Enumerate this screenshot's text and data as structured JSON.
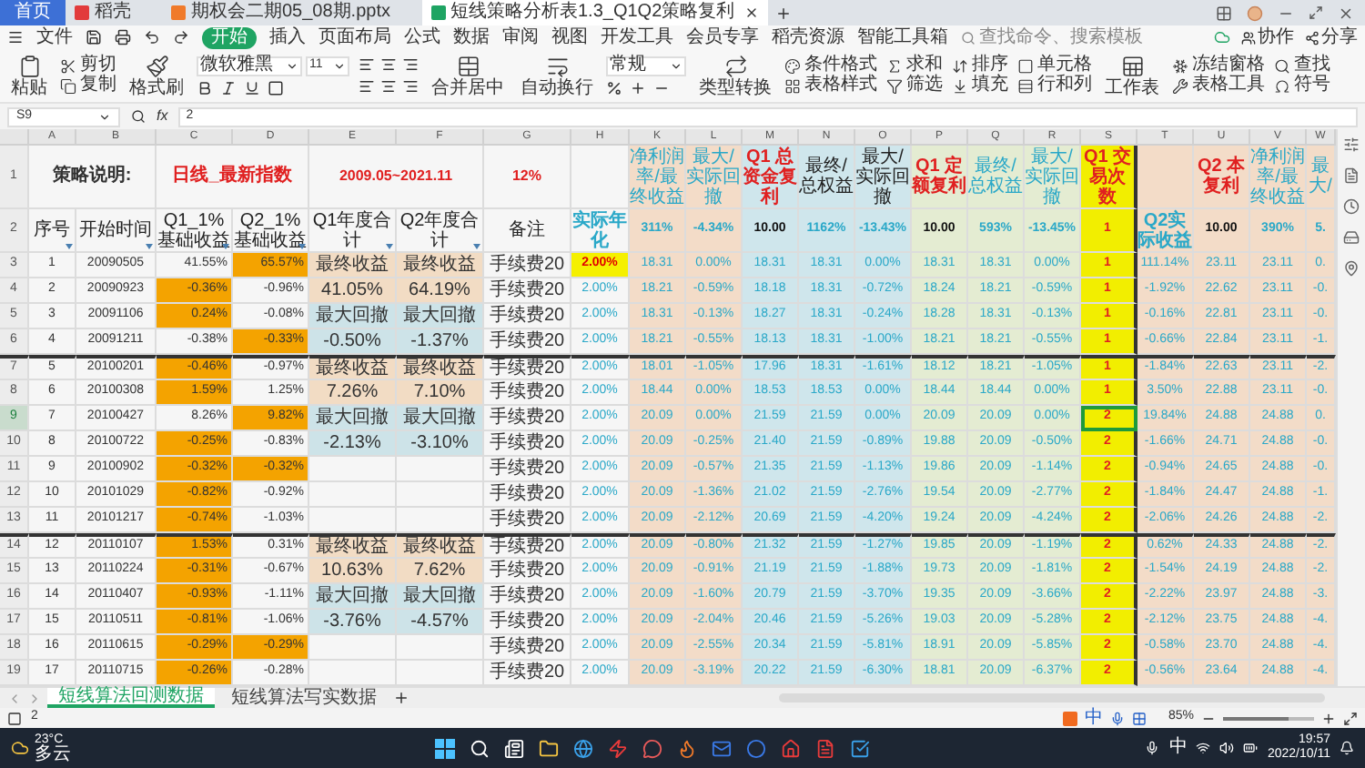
{
  "browser_tabs": [
    {
      "label": "首页",
      "kind": "home",
      "selected": false
    },
    {
      "label": "稻壳",
      "kind": "doc",
      "color": "#e23b3b",
      "selected": false
    },
    {
      "label": "期权会二期05_08期.pptx",
      "kind": "doc",
      "color": "#f07a2a",
      "selected": false
    },
    {
      "label": "短线策略分析表1.3_Q1Q2策略复利",
      "kind": "doc",
      "color": "#1fa463",
      "selected": true
    }
  ],
  "menu": {
    "file": "文件",
    "tabs": [
      {
        "label": "开始",
        "selected": true
      },
      {
        "label": "插入",
        "selected": false
      },
      {
        "label": "页面布局",
        "selected": false
      },
      {
        "label": "公式",
        "selected": false
      },
      {
        "label": "数据",
        "selected": false
      },
      {
        "label": "审阅",
        "selected": false
      },
      {
        "label": "视图",
        "selected": false
      },
      {
        "label": "开发工具",
        "selected": false
      },
      {
        "label": "会员专享",
        "selected": false
      },
      {
        "label": "稻壳资源",
        "selected": false
      },
      {
        "label": "智能工具箱",
        "selected": false
      }
    ],
    "search": {
      "placeholder": "查找命令、搜索模板"
    },
    "actions": [
      "协作",
      "分享"
    ]
  },
  "toolbar": {
    "font": "微软雅黑",
    "size": "11",
    "number_format": "常规",
    "groups_a": [
      [
        "粘贴"
      ],
      [
        "剪切",
        "复制"
      ],
      [
        "格式刷"
      ]
    ],
    "groups_b": [
      [
        "合并居中"
      ],
      [
        "自动换行"
      ]
    ],
    "groups_c": [
      [
        "类型转换"
      ],
      [
        "条件格式",
        "表格样式"
      ],
      [
        "求和",
        "筛选"
      ],
      [
        "排序",
        "填充"
      ],
      [
        "单元格",
        "行和列"
      ],
      [
        "工作表"
      ],
      [
        "冻结窗格",
        "表格工具"
      ],
      [
        "查找",
        "符号"
      ]
    ]
  },
  "formula_bar": {
    "cell": "S9",
    "fx": "fx",
    "value": "2"
  },
  "column_letters": [
    "A",
    "B",
    "C",
    "D",
    "E",
    "F",
    "G",
    "H",
    "K",
    "L",
    "M",
    "N",
    "O",
    "P",
    "Q",
    "R",
    "S",
    "T",
    "U",
    "V",
    "W"
  ],
  "header": {
    "row1": {
      "n": "1",
      "strategy": "策略说明:",
      "index": "日线_最新指数",
      "period": "2009.05~2021.11",
      "rate": "12%"
    },
    "row2": {
      "n": "2",
      "columns": [
        "序号",
        "开始时间",
        "Q1_1% 基础收益",
        "Q2_1% 基础收益",
        "Q1年度合计",
        "Q2年度合计",
        "备注",
        "实际年化"
      ]
    }
  },
  "right_headers": [
    {
      "text": "净利润率/最终收益",
      "kind": "accent"
    },
    {
      "text": "最大/实际回撤",
      "kind": "accent"
    },
    {
      "text": "Q1 总资金复利",
      "kind": "key"
    },
    {
      "text": "最终/总权益",
      "kind": "plain"
    },
    {
      "text": "最大/实际回撤",
      "kind": "plain"
    },
    {
      "text": "Q1 定额复利",
      "kind": "key"
    },
    {
      "text": "最终/总权益",
      "kind": "accent"
    },
    {
      "text": "最大/实际回撤",
      "kind": "accent"
    },
    {
      "text": "Q1 交易次数",
      "kind": "key"
    },
    {
      "kind": "none"
    },
    {
      "text": "Q2 本复利",
      "kind": "key"
    },
    {
      "text": "净利润率/最终收益",
      "kind": "accent"
    },
    {
      "text": "最大/",
      "kind": "accent"
    }
  ],
  "right_summary": [
    "311%",
    "-4.34%",
    "10.00",
    "1162%",
    "-13.43%",
    "10.00",
    "593%",
    "-13.45%",
    "1",
    "Q2实际收益",
    "10.00",
    "390%",
    "5."
  ],
  "rows": [
    {
      "n": "3",
      "seq": "1",
      "date": "20090505",
      "q1": {
        "text": "41.55%",
        "highlight": false
      },
      "q2": {
        "text": "65.57%",
        "highlight": true
      },
      "kind": "gain",
      "e": "最终收益",
      "f": "最终收益",
      "note": "手续费20",
      "rate": {
        "text": "2.00%",
        "highlight": true
      },
      "divider_above": false,
      "right_a": [
        "18.31",
        "0.00%",
        "18.31",
        "18.31",
        "0.00%",
        "18.31",
        "18.31",
        "0.00%"
      ],
      "count": {
        "text": "1",
        "selected": false
      },
      "right_b": [
        "111.14%",
        "23.11",
        "23.11",
        "0."
      ]
    },
    {
      "n": "4",
      "seq": "2",
      "date": "20090923",
      "q1": {
        "text": "-0.36%",
        "highlight": true
      },
      "q2": {
        "text": "-0.96%",
        "highlight": false
      },
      "kind": "gain",
      "e": "41.05%",
      "f": "64.19%",
      "note": "手续费20",
      "rate": {
        "text": "2.00%",
        "highlight": false
      },
      "divider_above": false,
      "right_a": [
        "18.21",
        "-0.59%",
        "18.18",
        "18.31",
        "-0.72%",
        "18.24",
        "18.21",
        "-0.59%"
      ],
      "count": {
        "text": "1",
        "selected": false
      },
      "right_b": [
        "-1.92%",
        "22.62",
        "23.11",
        "-0."
      ]
    },
    {
      "n": "5",
      "seq": "3",
      "date": "20091106",
      "q1": {
        "text": "0.24%",
        "highlight": true
      },
      "q2": {
        "text": "-0.08%",
        "highlight": false
      },
      "kind": "drawdown",
      "e": "最大回撤",
      "f": "最大回撤",
      "note": "手续费20",
      "rate": {
        "text": "2.00%",
        "highlight": false
      },
      "divider_above": false,
      "right_a": [
        "18.31",
        "-0.13%",
        "18.27",
        "18.31",
        "-0.24%",
        "18.28",
        "18.31",
        "-0.13%"
      ],
      "count": {
        "text": "1",
        "selected": false
      },
      "right_b": [
        "-0.16%",
        "22.81",
        "23.11",
        "-0."
      ]
    },
    {
      "n": "6",
      "seq": "4",
      "date": "20091211",
      "q1": {
        "text": "-0.38%",
        "highlight": false
      },
      "q2": {
        "text": "-0.33%",
        "highlight": true
      },
      "kind": "drawdown",
      "e": "-0.50%",
      "f": "-1.37%",
      "note": "手续费20",
      "rate": {
        "text": "2.00%",
        "highlight": false
      },
      "divider_above": false,
      "right_a": [
        "18.21",
        "-0.55%",
        "18.13",
        "18.31",
        "-1.00%",
        "18.21",
        "18.21",
        "-0.55%"
      ],
      "count": {
        "text": "1",
        "selected": false
      },
      "right_b": [
        "-0.66%",
        "22.84",
        "23.11",
        "-1."
      ]
    },
    {
      "n": "7",
      "seq": "5",
      "date": "20100201",
      "q1": {
        "text": "-0.46%",
        "highlight": true
      },
      "q2": {
        "text": "-0.97%",
        "highlight": false
      },
      "kind": "gain",
      "e": "最终收益",
      "f": "最终收益",
      "note": "手续费20",
      "rate": {
        "text": "2.00%",
        "highlight": false
      },
      "divider_above": true,
      "right_a": [
        "18.01",
        "-1.05%",
        "17.96",
        "18.31",
        "-1.61%",
        "18.12",
        "18.21",
        "-1.05%"
      ],
      "count": {
        "text": "1",
        "selected": false
      },
      "right_b": [
        "-1.84%",
        "22.63",
        "23.11",
        "-2."
      ]
    },
    {
      "n": "8",
      "seq": "6",
      "date": "20100308",
      "q1": {
        "text": "1.59%",
        "highlight": true
      },
      "q2": {
        "text": "1.25%",
        "highlight": false
      },
      "kind": "gain",
      "e": "7.26%",
      "f": "7.10%",
      "note": "手续费20",
      "rate": {
        "text": "2.00%",
        "highlight": false
      },
      "divider_above": false,
      "right_a": [
        "18.44",
        "0.00%",
        "18.53",
        "18.53",
        "0.00%",
        "18.44",
        "18.44",
        "0.00%"
      ],
      "count": {
        "text": "1",
        "selected": false
      },
      "right_b": [
        "3.50%",
        "22.88",
        "23.11",
        "-0."
      ]
    },
    {
      "n": "9",
      "seq": "7",
      "date": "20100427",
      "q1": {
        "text": "8.26%",
        "highlight": false
      },
      "q2": {
        "text": "9.82%",
        "highlight": true
      },
      "kind": "drawdown",
      "e": "最大回撤",
      "f": "最大回撤",
      "note": "手续费20",
      "rate": {
        "text": "2.00%",
        "highlight": false
      },
      "divider_above": false,
      "right_a": [
        "20.09",
        "0.00%",
        "21.59",
        "21.59",
        "0.00%",
        "20.09",
        "20.09",
        "0.00%"
      ],
      "count": {
        "text": "2",
        "selected": true
      },
      "right_b": [
        "19.84%",
        "24.88",
        "24.88",
        "0."
      ]
    },
    {
      "n": "10",
      "seq": "8",
      "date": "20100722",
      "q1": {
        "text": "-0.25%",
        "highlight": true
      },
      "q2": {
        "text": "-0.83%",
        "highlight": false
      },
      "kind": "drawdown",
      "e": "-2.13%",
      "f": "-3.10%",
      "note": "手续费20",
      "rate": {
        "text": "2.00%",
        "highlight": false
      },
      "divider_above": false,
      "right_a": [
        "20.09",
        "-0.25%",
        "21.40",
        "21.59",
        "-0.89%",
        "19.88",
        "20.09",
        "-0.50%"
      ],
      "count": {
        "text": "2",
        "selected": false
      },
      "right_b": [
        "-1.66%",
        "24.71",
        "24.88",
        "-0."
      ]
    },
    {
      "n": "11",
      "seq": "9",
      "date": "20100902",
      "q1": {
        "text": "-0.32%",
        "highlight": true
      },
      "q2": {
        "text": "-0.32%",
        "highlight": true
      },
      "kind": "blank",
      "note": "手续费20",
      "rate": {
        "text": "2.00%",
        "highlight": false
      },
      "divider_above": false,
      "right_a": [
        "20.09",
        "-0.57%",
        "21.35",
        "21.59",
        "-1.13%",
        "19.86",
        "20.09",
        "-1.14%"
      ],
      "count": {
        "text": "2",
        "selected": false
      },
      "right_b": [
        "-0.94%",
        "24.65",
        "24.88",
        "-0."
      ]
    },
    {
      "n": "12",
      "seq": "10",
      "date": "20101029",
      "q1": {
        "text": "-0.82%",
        "highlight": true
      },
      "q2": {
        "text": "-0.92%",
        "highlight": false
      },
      "kind": "blank",
      "note": "手续费20",
      "rate": {
        "text": "2.00%",
        "highlight": false
      },
      "divider_above": false,
      "right_a": [
        "20.09",
        "-1.36%",
        "21.02",
        "21.59",
        "-2.76%",
        "19.54",
        "20.09",
        "-2.77%"
      ],
      "count": {
        "text": "2",
        "selected": false
      },
      "right_b": [
        "-1.84%",
        "24.47",
        "24.88",
        "-1."
      ]
    },
    {
      "n": "13",
      "seq": "11",
      "date": "20101217",
      "q1": {
        "text": "-0.74%",
        "highlight": true
      },
      "q2": {
        "text": "-1.03%",
        "highlight": false
      },
      "kind": "blank",
      "note": "手续费20",
      "rate": {
        "text": "2.00%",
        "highlight": false
      },
      "divider_above": false,
      "right_a": [
        "20.09",
        "-2.12%",
        "20.69",
        "21.59",
        "-4.20%",
        "19.24",
        "20.09",
        "-4.24%"
      ],
      "count": {
        "text": "2",
        "selected": false
      },
      "right_b": [
        "-2.06%",
        "24.26",
        "24.88",
        "-2."
      ]
    },
    {
      "n": "14",
      "seq": "12",
      "date": "20110107",
      "q1": {
        "text": "1.53%",
        "highlight": true
      },
      "q2": {
        "text": "0.31%",
        "highlight": false
      },
      "kind": "gain",
      "e": "最终收益",
      "f": "最终收益",
      "note": "手续费20",
      "rate": {
        "text": "2.00%",
        "highlight": false
      },
      "divider_above": true,
      "right_a": [
        "20.09",
        "-0.80%",
        "21.32",
        "21.59",
        "-1.27%",
        "19.85",
        "20.09",
        "-1.19%"
      ],
      "count": {
        "text": "2",
        "selected": false
      },
      "right_b": [
        "0.62%",
        "24.33",
        "24.88",
        "-2."
      ]
    },
    {
      "n": "15",
      "seq": "13",
      "date": "20110224",
      "q1": {
        "text": "-0.31%",
        "highlight": true
      },
      "q2": {
        "text": "-0.67%",
        "highlight": false
      },
      "kind": "gain",
      "e": "10.63%",
      "f": "7.62%",
      "note": "手续费20",
      "rate": {
        "text": "2.00%",
        "highlight": false
      },
      "divider_above": false,
      "right_a": [
        "20.09",
        "-0.91%",
        "21.19",
        "21.59",
        "-1.88%",
        "19.73",
        "20.09",
        "-1.81%"
      ],
      "count": {
        "text": "2",
        "selected": false
      },
      "right_b": [
        "-1.54%",
        "24.19",
        "24.88",
        "-2."
      ]
    },
    {
      "n": "16",
      "seq": "14",
      "date": "20110407",
      "q1": {
        "text": "-0.93%",
        "highlight": true
      },
      "q2": {
        "text": "-1.11%",
        "highlight": false
      },
      "kind": "drawdown",
      "e": "最大回撤",
      "f": "最大回撤",
      "note": "手续费20",
      "rate": {
        "text": "2.00%",
        "highlight": false
      },
      "divider_above": false,
      "right_a": [
        "20.09",
        "-1.60%",
        "20.79",
        "21.59",
        "-3.70%",
        "19.35",
        "20.09",
        "-3.66%"
      ],
      "count": {
        "text": "2",
        "selected": false
      },
      "right_b": [
        "-2.22%",
        "23.97",
        "24.88",
        "-3."
      ]
    },
    {
      "n": "17",
      "seq": "15",
      "date": "20110511",
      "q1": {
        "text": "-0.81%",
        "highlight": true
      },
      "q2": {
        "text": "-1.06%",
        "highlight": false
      },
      "kind": "drawdown",
      "e": "-3.76%",
      "f": "-4.57%",
      "note": "手续费20",
      "rate": {
        "text": "2.00%",
        "highlight": false
      },
      "divider_above": false,
      "right_a": [
        "20.09",
        "-2.04%",
        "20.46",
        "21.59",
        "-5.26%",
        "19.03",
        "20.09",
        "-5.28%"
      ],
      "count": {
        "text": "2",
        "selected": false
      },
      "right_b": [
        "-2.12%",
        "23.75",
        "24.88",
        "-4."
      ]
    },
    {
      "n": "18",
      "seq": "16",
      "date": "20110615",
      "q1": {
        "text": "-0.29%",
        "highlight": true
      },
      "q2": {
        "text": "-0.29%",
        "highlight": true
      },
      "kind": "blank",
      "note": "手续费20",
      "rate": {
        "text": "2.00%",
        "highlight": false
      },
      "divider_above": false,
      "right_a": [
        "20.09",
        "-2.55%",
        "20.34",
        "21.59",
        "-5.81%",
        "18.91",
        "20.09",
        "-5.85%"
      ],
      "count": {
        "text": "2",
        "selected": false
      },
      "right_b": [
        "-0.58%",
        "23.70",
        "24.88",
        "-4."
      ]
    },
    {
      "n": "19",
      "seq": "17",
      "date": "20110715",
      "q1": {
        "text": "-0.26%",
        "highlight": true
      },
      "q2": {
        "text": "-0.28%",
        "highlight": false
      },
      "kind": "blank",
      "note": "手续费20",
      "rate": {
        "text": "2.00%",
        "highlight": false
      },
      "divider_above": false,
      "right_a": [
        "20.09",
        "-3.19%",
        "20.22",
        "21.59",
        "-6.30%",
        "18.81",
        "20.09",
        "-6.37%"
      ],
      "count": {
        "text": "2",
        "selected": false
      },
      "right_b": [
        "-0.56%",
        "23.64",
        "24.88",
        "-4."
      ]
    }
  ],
  "sheet_tabs": [
    {
      "label": "短线算法回测数据",
      "selected": true
    },
    {
      "label": "短线算法写实数据",
      "selected": false
    }
  ],
  "status_bar": {
    "count": "2",
    "ime": "中",
    "zoom": "85%",
    "level": 0.72
  },
  "taskbar": {
    "temperature": "23°C",
    "weather": "多云",
    "ime": "中",
    "time": "19:57",
    "date": "2022/10/11"
  }
}
